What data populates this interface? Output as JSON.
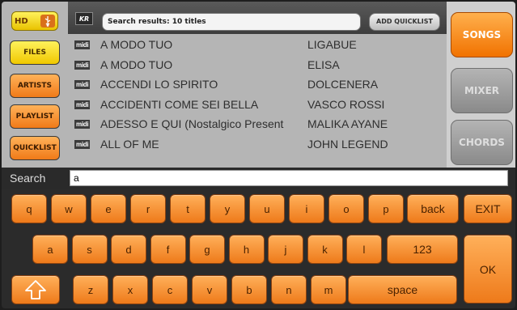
{
  "left_panel": {
    "hd_label": "HD",
    "usb_icon": "usb-icon",
    "buttons": [
      "FILES",
      "ARTISTS",
      "PLAYLIST",
      "QUICKLIST"
    ],
    "active": "FILES"
  },
  "header": {
    "logo_text": "KR",
    "search_results": "Search results: 10 titles",
    "add_quicklist_label": "ADD QUICKLIST"
  },
  "song_list": {
    "type_label": "midi",
    "rows": [
      {
        "title": "A MODO TUO",
        "artist": "LIGABUE"
      },
      {
        "title": "A MODO TUO",
        "artist": "ELISA"
      },
      {
        "title": "ACCENDI LO SPIRITO",
        "artist": "DOLCENERA"
      },
      {
        "title": "ACCIDENTI COME SEI BELLA",
        "artist": "VASCO ROSSI"
      },
      {
        "title": "ADESSO E QUI (Nostalgico Present",
        "artist": "MALIKA AYANE"
      },
      {
        "title": "ALL OF ME",
        "artist": "JOHN LEGEND"
      }
    ]
  },
  "mode_tabs": {
    "songs": "SONGS",
    "mixer": "MIXER",
    "chords": "CHORDS",
    "active": "SONGS"
  },
  "search": {
    "label": "Search",
    "value": "a"
  },
  "keyboard": {
    "row1": [
      "q",
      "w",
      "e",
      "r",
      "t",
      "y",
      "u",
      "i",
      "o",
      "p"
    ],
    "back": "back",
    "row2": [
      "a",
      "s",
      "d",
      "f",
      "g",
      "h",
      "j",
      "k",
      "l"
    ],
    "numbers": "123",
    "row3": [
      "z",
      "x",
      "c",
      "v",
      "b",
      "n",
      "m"
    ],
    "shift_icon": "shift-arrow-icon",
    "space": "space",
    "exit": "EXIT",
    "ok": "OK"
  },
  "colors": {
    "accent_orange": "#f07a18",
    "accent_yellow": "#fff25c",
    "list_background": "#b5b5b5",
    "inactive_tab": "#9a9a9a"
  }
}
